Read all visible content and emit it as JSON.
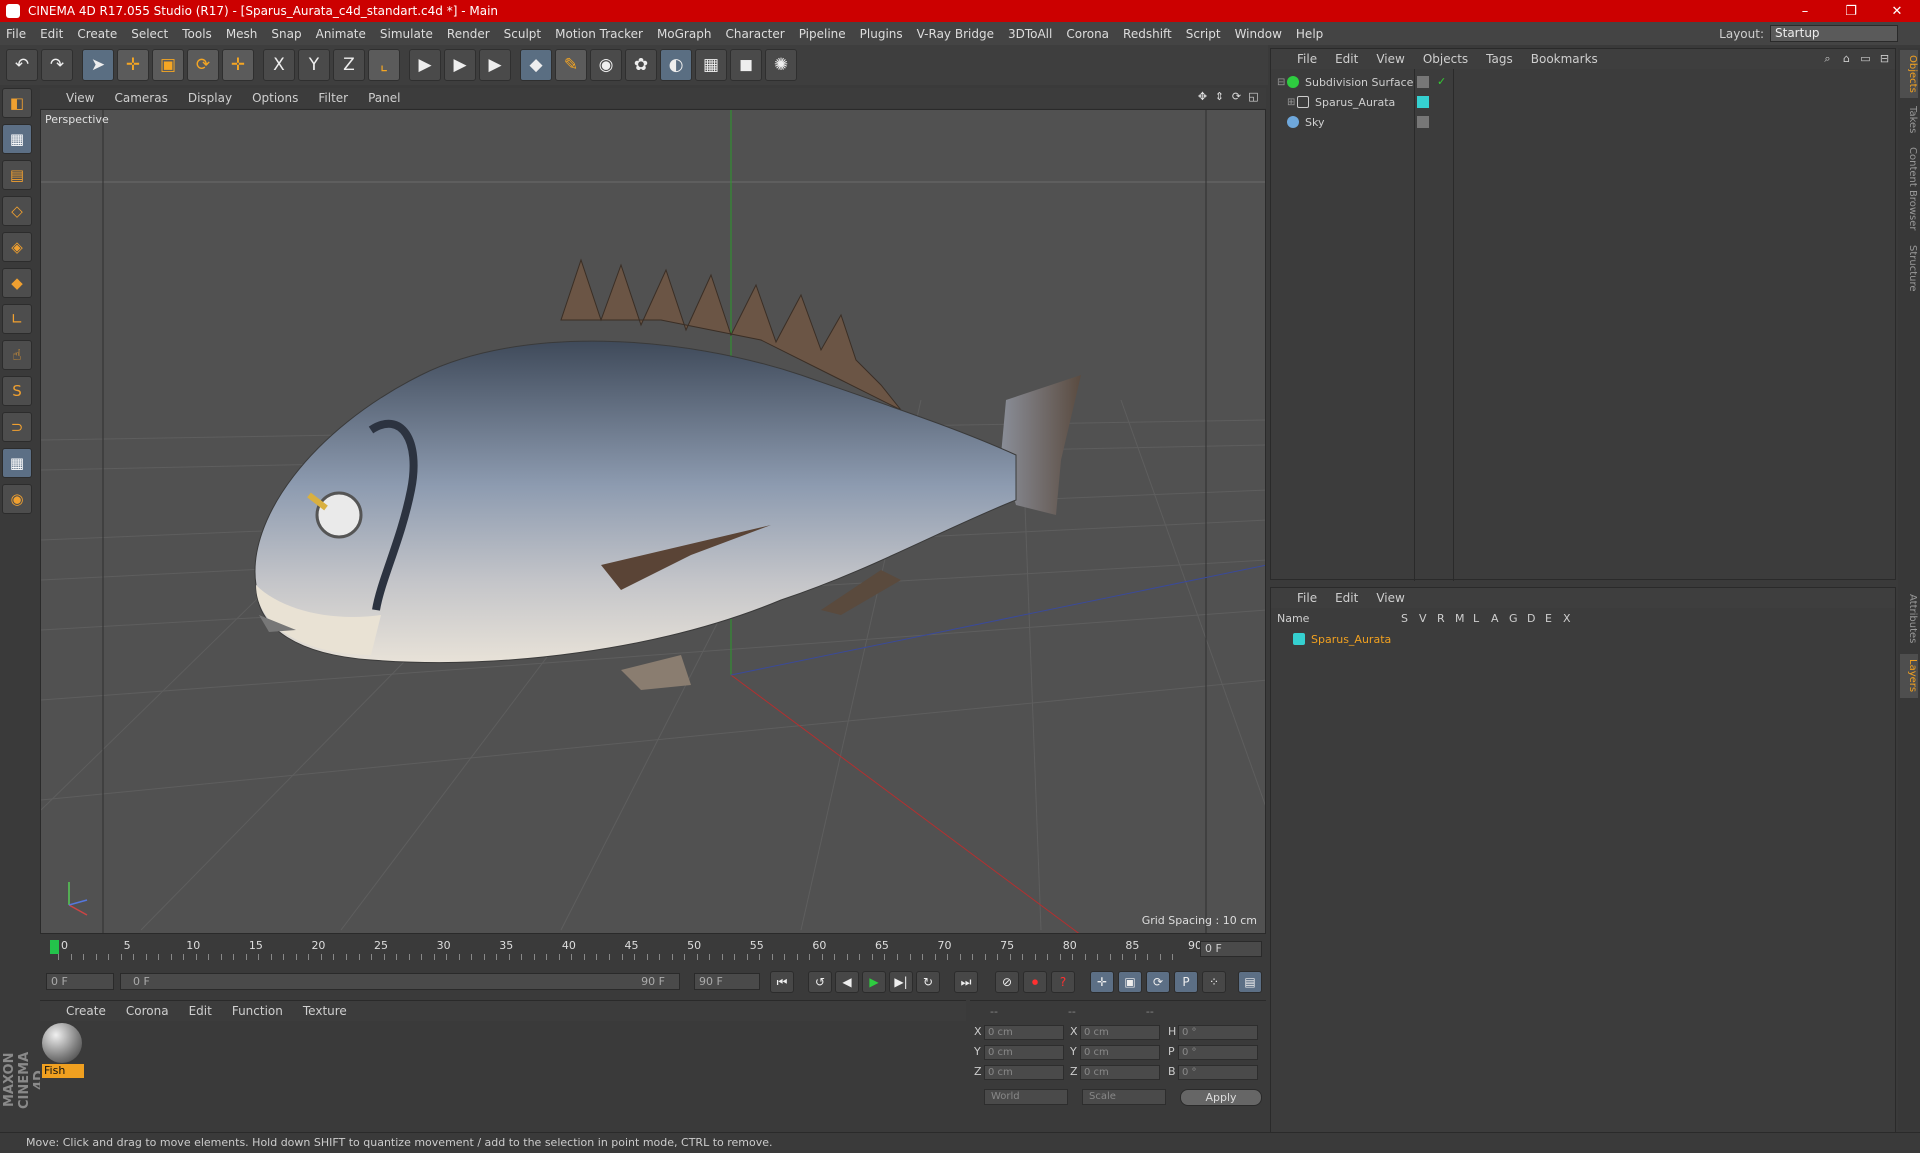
{
  "window": {
    "title": "CINEMA 4D R17.055 Studio (R17) - [Sparus_Aurata_c4d_standart.c4d *] - Main",
    "controls": [
      "–",
      "❐",
      "✕"
    ]
  },
  "menubar": {
    "items": [
      "File",
      "Edit",
      "Create",
      "Select",
      "Tools",
      "Mesh",
      "Snap",
      "Animate",
      "Simulate",
      "Render",
      "Sculpt",
      "Motion Tracker",
      "MoGraph",
      "Character",
      "Pipeline",
      "Plugins",
      "V-Ray Bridge",
      "3DToAll",
      "Corona",
      "Redshift",
      "Script",
      "Window",
      "Help"
    ],
    "layout_label": "Layout:",
    "layout_value": "Startup"
  },
  "toolbar": {
    "undo": "↶",
    "redo": "↷",
    "select": "➤",
    "move": "✛",
    "scale": "▣",
    "rotate": "⟳",
    "last": "✛",
    "x": "X",
    "y": "Y",
    "z": "Z",
    "world": "⌞",
    "render_view": "▶",
    "render_pic": "▶",
    "render_settings": "▶",
    "cube": "◆",
    "pen": "✎",
    "subdiv": "◉",
    "cloner": "✿",
    "deformer": "◐",
    "floor": "▦",
    "camera": "◼",
    "light": "✺"
  },
  "left_tools": [
    "◧",
    "▦",
    "▤",
    "◇",
    "◈",
    "◆",
    "∟",
    "☝",
    "S",
    "⊃",
    "▦",
    "◉"
  ],
  "viewport": {
    "menu": [
      "View",
      "Cameras",
      "Display",
      "Options",
      "Filter",
      "Panel"
    ],
    "label": "Perspective",
    "grid_spacing": "Grid Spacing : 10 cm",
    "icons": [
      "✥",
      "⇕",
      "⟳",
      "◱"
    ]
  },
  "timeline": {
    "ticks": [
      "0",
      "5",
      "10",
      "15",
      "20",
      "25",
      "30",
      "35",
      "40",
      "45",
      "50",
      "55",
      "60",
      "65",
      "70",
      "75",
      "80",
      "85",
      "90"
    ],
    "current_frame": "0 F"
  },
  "transport": {
    "start": "0 F",
    "range_start": "0 F",
    "range_end": "90 F",
    "end": "90 F",
    "buttons": [
      "⏮",
      "↺",
      "◀",
      "▶",
      "▶|",
      "↻",
      "⏭"
    ],
    "key_buttons": [
      "⊘",
      "⏺",
      "?",
      "✛",
      "▣",
      "⟳",
      "P",
      "⁘",
      "▤"
    ]
  },
  "material_manager": {
    "menu": [
      "Create",
      "Corona",
      "Edit",
      "Function",
      "Texture"
    ],
    "materials": [
      {
        "name": "Fish"
      }
    ]
  },
  "coordinates": {
    "headers": [
      "--",
      "--",
      "--"
    ],
    "rows": [
      {
        "a": "X",
        "av": "0 cm",
        "b": "X",
        "bv": "0 cm",
        "c": "H",
        "cv": "0 °"
      },
      {
        "a": "Y",
        "av": "0 cm",
        "b": "Y",
        "bv": "0 cm",
        "c": "P",
        "cv": "0 °"
      },
      {
        "a": "Z",
        "av": "0 cm",
        "b": "Z",
        "bv": "0 cm",
        "c": "B",
        "cv": "0 °"
      }
    ],
    "mode1": "World",
    "mode2": "Scale",
    "apply": "Apply"
  },
  "status": "Move: Click and drag to move elements. Hold down SHIFT to quantize movement / add to the selection in point mode, CTRL to remove.",
  "object_manager": {
    "menu": [
      "File",
      "Edit",
      "View",
      "Objects",
      "Tags",
      "Bookmarks"
    ],
    "objects": [
      {
        "name": "Subdivision Surface",
        "color": "#2ecc40"
      },
      {
        "name": "Sparus_Aurata",
        "color": "#cfcfcf"
      },
      {
        "name": "Sky",
        "color": "#6fa8dc"
      }
    ]
  },
  "layer_manager": {
    "menu": [
      "File",
      "Edit",
      "View"
    ],
    "columns": [
      "Name",
      "S",
      "V",
      "R",
      "M",
      "L",
      "A",
      "G",
      "D",
      "E",
      "X"
    ],
    "layers": [
      {
        "name": "Sparus_Aurata",
        "color": "#35d0d0"
      }
    ]
  },
  "side_tabs": [
    "Objects",
    "Takes",
    "Content Browser",
    "Structure",
    "Attributes",
    "Layers"
  ],
  "branding": "MAXON CINEMA 4D",
  "colors": {
    "accent": "#f0a020",
    "titlebar": "#cc0000"
  }
}
